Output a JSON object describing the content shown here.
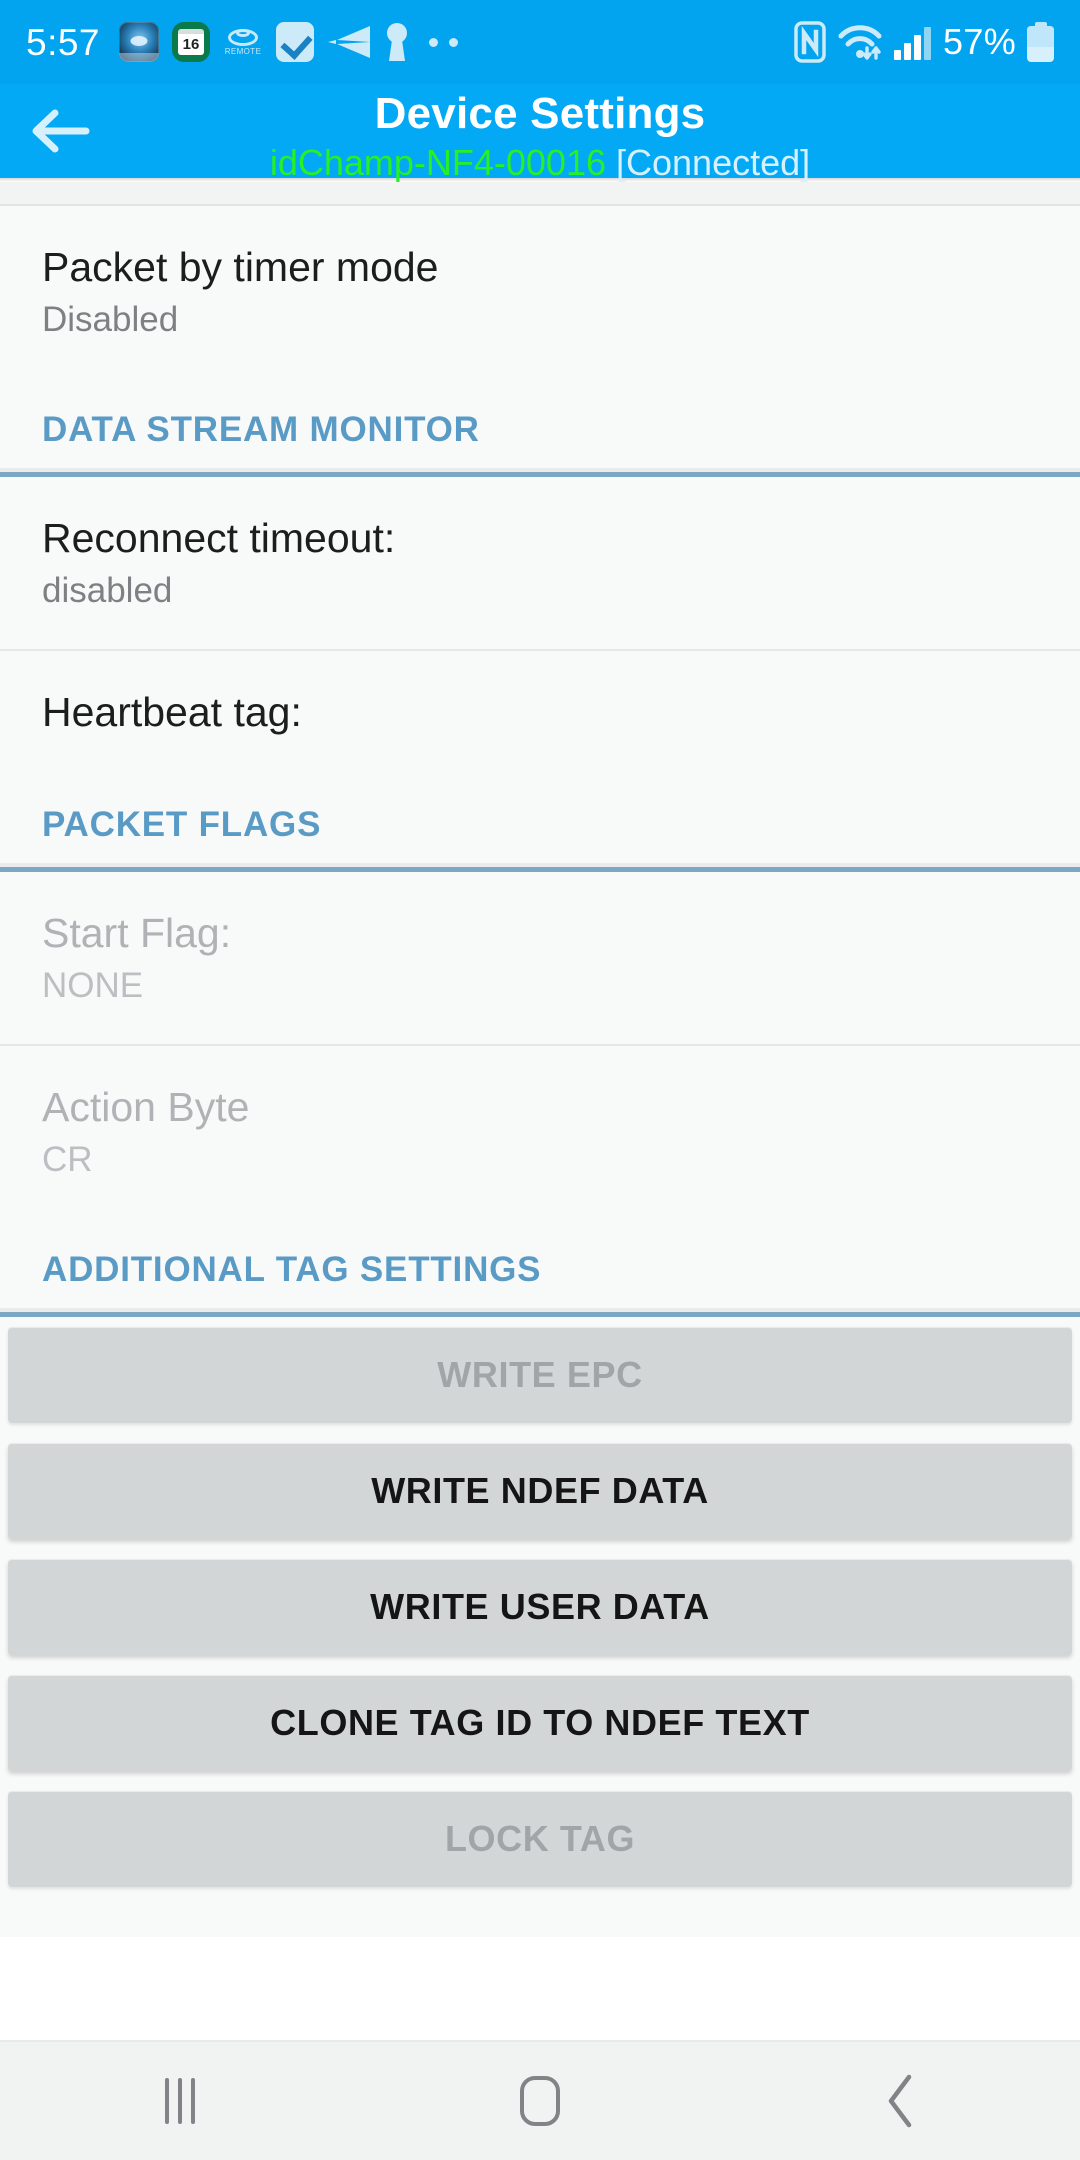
{
  "status_bar": {
    "time": "5:57",
    "battery_percent": "57%",
    "icons_left": [
      "view-app-icon",
      "calendar-icon",
      "toyota-remote-icon",
      "checkbox-icon",
      "paper-plane-icon",
      "keyhole-vpn-icon",
      "more-dots-icon"
    ],
    "calendar_day": "16",
    "remote_label": "REMOTE",
    "icons_right": [
      "nfc-icon",
      "wifi-icon",
      "signal-bars-icon",
      "battery-icon"
    ]
  },
  "app_bar": {
    "back_icon": "back-arrow-icon",
    "title": "Device Settings",
    "device_name": "idChamp-NF4-00016",
    "connection_state": "[Connected]"
  },
  "colors": {
    "status_bar": "#02a3ef",
    "app_bar": "#03a9f4",
    "device_name": "#27f024",
    "section_header": "#5a9bc6",
    "section_rule": "#7aa8c4",
    "content_bg": "#f8f9f9",
    "button_bg": "#d3d6d7",
    "button_text_enabled": "#151515",
    "button_text_disabled": "#a2a5a7"
  },
  "preferences": [
    {
      "title": "Packet by timer mode",
      "summary": "Disabled",
      "enabled": true
    }
  ],
  "sections": [
    {
      "label": "DATA STREAM MONITOR",
      "rows": [
        {
          "title": "Reconnect timeout:",
          "summary": "disabled",
          "enabled": true
        },
        {
          "title": "Heartbeat tag:",
          "summary": "",
          "enabled": true
        }
      ]
    },
    {
      "label": "PACKET FLAGS",
      "rows": [
        {
          "title": "Start Flag:",
          "summary": "NONE",
          "enabled": false
        },
        {
          "title": "Action Byte",
          "summary": "CR",
          "enabled": false
        }
      ]
    },
    {
      "label": "ADDITIONAL TAG SETTINGS",
      "rows": []
    }
  ],
  "buttons": [
    {
      "label": "WRITE EPC",
      "enabled": false
    },
    {
      "label": "WRITE NDEF DATA",
      "enabled": true
    },
    {
      "label": "WRITE USER DATA",
      "enabled": true
    },
    {
      "label": "CLONE TAG ID TO NDEF TEXT",
      "enabled": true
    },
    {
      "label": "LOCK TAG",
      "enabled": false
    }
  ],
  "nav_bar": {
    "recents_icon": "recents-icon",
    "home_icon": "home-icon",
    "back_icon": "back-chevron-icon"
  }
}
